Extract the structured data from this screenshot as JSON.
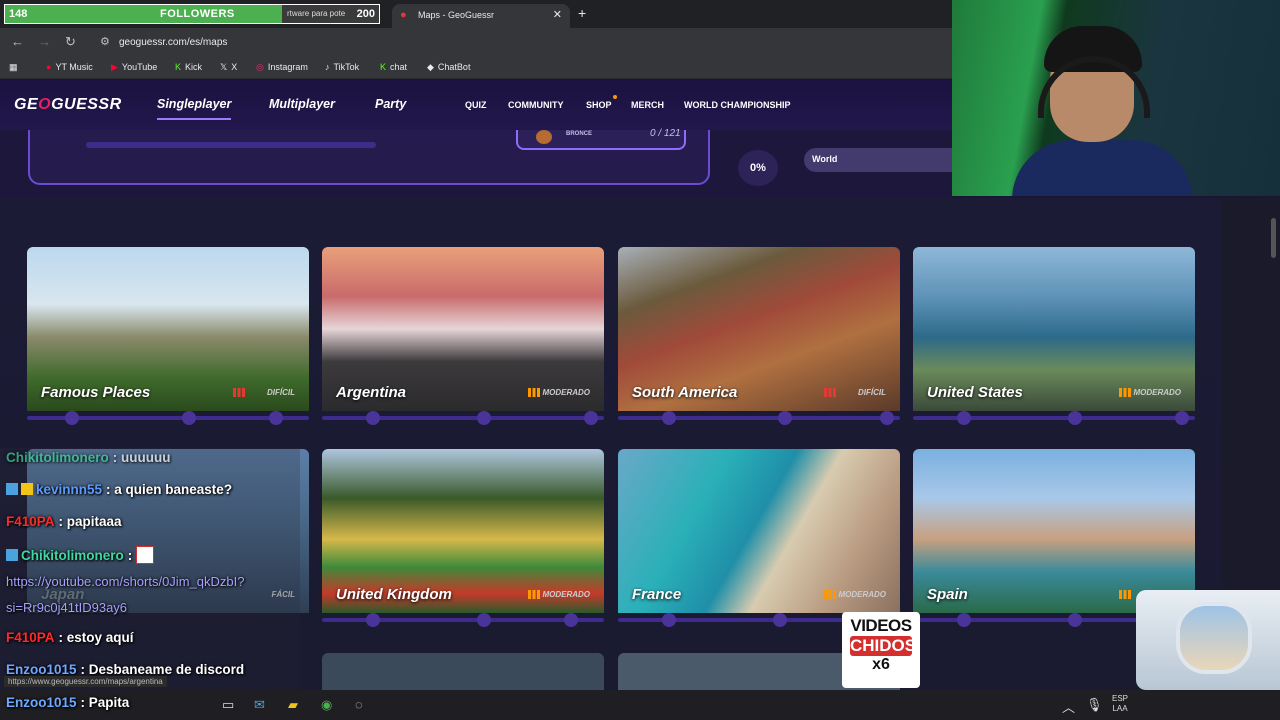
{
  "followers": {
    "count": "148",
    "label": "FOLLOWERS",
    "ticker": "rtware para pote",
    "goal": "200",
    "progress": 0.74
  },
  "browser": {
    "tab_title": "Maps - GeoGuessr",
    "url": "geoguessr.com/es/maps",
    "bookmarks": [
      "YT Music",
      "YouTube",
      "Kick",
      "X",
      "Instagram",
      "TikTok",
      "chat",
      "ChatBot"
    ]
  },
  "geoguessr": {
    "logo": {
      "left": "GE",
      "mid": "O",
      "right": "GUESSR"
    },
    "main_nav": [
      "Singleplayer",
      "Multiplayer",
      "Party"
    ],
    "sub_nav": [
      "QUIZ",
      "COMMUNITY",
      "SHOP",
      "MERCH",
      "WORLD CHAMPIONSHIP"
    ],
    "hero": {
      "rank": "BRONCE",
      "score": "0 / 121",
      "percent": "0%",
      "world": "World"
    },
    "maps": [
      {
        "name": "Famous Places",
        "difficulty": "DIFÍCIL"
      },
      {
        "name": "Argentina",
        "difficulty": "MODERADO"
      },
      {
        "name": "South America",
        "difficulty": "DIFÍCIL"
      },
      {
        "name": "United States",
        "difficulty": "MODERADO"
      },
      {
        "name": "Japan",
        "difficulty": "FÁCIL"
      },
      {
        "name": "United Kingdom",
        "difficulty": "MODERADO"
      },
      {
        "name": "France",
        "difficulty": "MODERADO"
      },
      {
        "name": "Spain",
        "difficulty": "M"
      }
    ]
  },
  "chat": [
    {
      "user": "Chikitolimonero",
      "text": ": uuuuuu",
      "color": "#3ed8a0"
    },
    {
      "user": "kevinnn55",
      "text": ": a quien baneaste?",
      "color": "#5b9bff"
    },
    {
      "user": "F410PA",
      "text": ": papitaaa",
      "color": "#ff2a2a"
    },
    {
      "user": "Chikitolimonero",
      "text": ":",
      "color": "#3ed8a0"
    },
    {
      "link1": "https://youtube.com/shorts/0Jim_qkDzbI?",
      "link2": "si=Rr9c0j41tID93ay6"
    },
    {
      "user": "F410PA",
      "text": ": estoy aquí",
      "color": "#ff2a2a"
    },
    {
      "user": "Enzoo1015",
      "text": ": Desbaneame de discord",
      "color": "#6ea8ff"
    },
    {
      "user": "Enzoo1015",
      "text": ": Papita",
      "color": "#6ea8ff"
    }
  ],
  "overlay": {
    "videos_l1": "VIDEOS",
    "videos_l2": "CHIDOS",
    "videos_l3": "x6"
  },
  "status_url": "https://www.geoguessr.com/maps/argentina",
  "taskbar": {
    "lang1": "ESP",
    "lang2": "LAA"
  }
}
